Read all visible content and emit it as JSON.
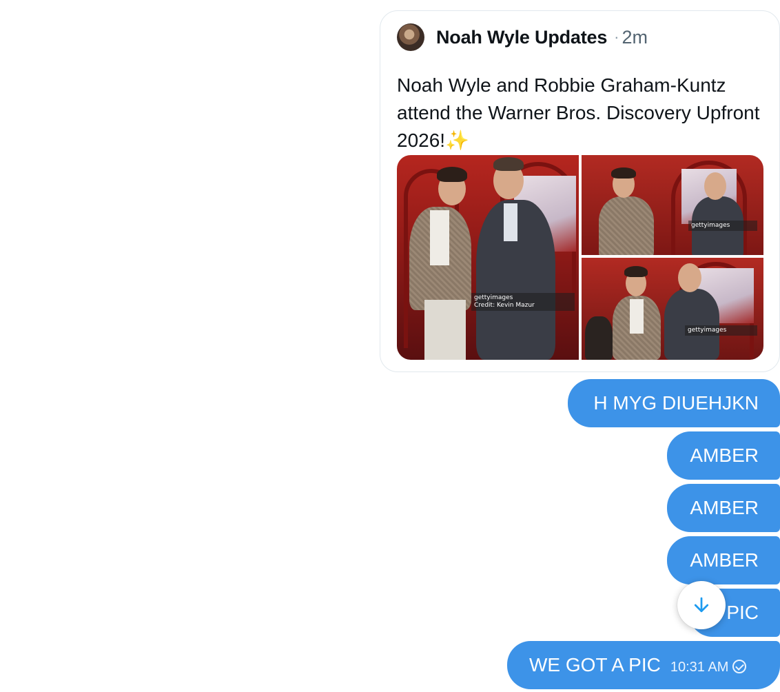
{
  "quote_card": {
    "author": "Noah Wyle Updates",
    "separator": "·",
    "time_ago": "2m",
    "text": "Noah Wyle and Robbie Graham-Kuntz attend the Warner Bros. Discovery Upfront 2026!",
    "emoji": "✨",
    "media": {
      "watermark_main": "gettyimages",
      "watermark_credit": "Credit: Kevin Mazur"
    }
  },
  "messages": [
    {
      "text": "H MYG DIUEHJKN"
    },
    {
      "text": "AMBER"
    },
    {
      "text": "AMBER"
    },
    {
      "text": "AMBER"
    },
    {
      "text": "PIC"
    },
    {
      "text": "WE GOT A PIC",
      "time": "10:31 AM"
    }
  ],
  "colors": {
    "bubble": "#3d93e8",
    "scroll_arrow": "#1d9bf0"
  },
  "icons": {
    "scroll": "arrow-down-icon",
    "read_receipt": "check-circle-icon"
  }
}
